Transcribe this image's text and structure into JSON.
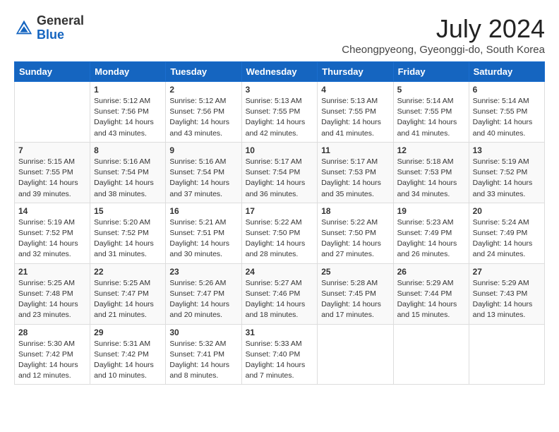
{
  "header": {
    "logo_general": "General",
    "logo_blue": "Blue",
    "month_title": "July 2024",
    "location": "Cheongpyeong, Gyeonggi-do, South Korea"
  },
  "weekdays": [
    "Sunday",
    "Monday",
    "Tuesday",
    "Wednesday",
    "Thursday",
    "Friday",
    "Saturday"
  ],
  "weeks": [
    [
      {
        "day": "",
        "info": ""
      },
      {
        "day": "1",
        "info": "Sunrise: 5:12 AM\nSunset: 7:56 PM\nDaylight: 14 hours\nand 43 minutes."
      },
      {
        "day": "2",
        "info": "Sunrise: 5:12 AM\nSunset: 7:56 PM\nDaylight: 14 hours\nand 43 minutes."
      },
      {
        "day": "3",
        "info": "Sunrise: 5:13 AM\nSunset: 7:55 PM\nDaylight: 14 hours\nand 42 minutes."
      },
      {
        "day": "4",
        "info": "Sunrise: 5:13 AM\nSunset: 7:55 PM\nDaylight: 14 hours\nand 41 minutes."
      },
      {
        "day": "5",
        "info": "Sunrise: 5:14 AM\nSunset: 7:55 PM\nDaylight: 14 hours\nand 41 minutes."
      },
      {
        "day": "6",
        "info": "Sunrise: 5:14 AM\nSunset: 7:55 PM\nDaylight: 14 hours\nand 40 minutes."
      }
    ],
    [
      {
        "day": "7",
        "info": "Sunrise: 5:15 AM\nSunset: 7:55 PM\nDaylight: 14 hours\nand 39 minutes."
      },
      {
        "day": "8",
        "info": "Sunrise: 5:16 AM\nSunset: 7:54 PM\nDaylight: 14 hours\nand 38 minutes."
      },
      {
        "day": "9",
        "info": "Sunrise: 5:16 AM\nSunset: 7:54 PM\nDaylight: 14 hours\nand 37 minutes."
      },
      {
        "day": "10",
        "info": "Sunrise: 5:17 AM\nSunset: 7:54 PM\nDaylight: 14 hours\nand 36 minutes."
      },
      {
        "day": "11",
        "info": "Sunrise: 5:17 AM\nSunset: 7:53 PM\nDaylight: 14 hours\nand 35 minutes."
      },
      {
        "day": "12",
        "info": "Sunrise: 5:18 AM\nSunset: 7:53 PM\nDaylight: 14 hours\nand 34 minutes."
      },
      {
        "day": "13",
        "info": "Sunrise: 5:19 AM\nSunset: 7:52 PM\nDaylight: 14 hours\nand 33 minutes."
      }
    ],
    [
      {
        "day": "14",
        "info": "Sunrise: 5:19 AM\nSunset: 7:52 PM\nDaylight: 14 hours\nand 32 minutes."
      },
      {
        "day": "15",
        "info": "Sunrise: 5:20 AM\nSunset: 7:52 PM\nDaylight: 14 hours\nand 31 minutes."
      },
      {
        "day": "16",
        "info": "Sunrise: 5:21 AM\nSunset: 7:51 PM\nDaylight: 14 hours\nand 30 minutes."
      },
      {
        "day": "17",
        "info": "Sunrise: 5:22 AM\nSunset: 7:50 PM\nDaylight: 14 hours\nand 28 minutes."
      },
      {
        "day": "18",
        "info": "Sunrise: 5:22 AM\nSunset: 7:50 PM\nDaylight: 14 hours\nand 27 minutes."
      },
      {
        "day": "19",
        "info": "Sunrise: 5:23 AM\nSunset: 7:49 PM\nDaylight: 14 hours\nand 26 minutes."
      },
      {
        "day": "20",
        "info": "Sunrise: 5:24 AM\nSunset: 7:49 PM\nDaylight: 14 hours\nand 24 minutes."
      }
    ],
    [
      {
        "day": "21",
        "info": "Sunrise: 5:25 AM\nSunset: 7:48 PM\nDaylight: 14 hours\nand 23 minutes."
      },
      {
        "day": "22",
        "info": "Sunrise: 5:25 AM\nSunset: 7:47 PM\nDaylight: 14 hours\nand 21 minutes."
      },
      {
        "day": "23",
        "info": "Sunrise: 5:26 AM\nSunset: 7:47 PM\nDaylight: 14 hours\nand 20 minutes."
      },
      {
        "day": "24",
        "info": "Sunrise: 5:27 AM\nSunset: 7:46 PM\nDaylight: 14 hours\nand 18 minutes."
      },
      {
        "day": "25",
        "info": "Sunrise: 5:28 AM\nSunset: 7:45 PM\nDaylight: 14 hours\nand 17 minutes."
      },
      {
        "day": "26",
        "info": "Sunrise: 5:29 AM\nSunset: 7:44 PM\nDaylight: 14 hours\nand 15 minutes."
      },
      {
        "day": "27",
        "info": "Sunrise: 5:29 AM\nSunset: 7:43 PM\nDaylight: 14 hours\nand 13 minutes."
      }
    ],
    [
      {
        "day": "28",
        "info": "Sunrise: 5:30 AM\nSunset: 7:42 PM\nDaylight: 14 hours\nand 12 minutes."
      },
      {
        "day": "29",
        "info": "Sunrise: 5:31 AM\nSunset: 7:42 PM\nDaylight: 14 hours\nand 10 minutes."
      },
      {
        "day": "30",
        "info": "Sunrise: 5:32 AM\nSunset: 7:41 PM\nDaylight: 14 hours\nand 8 minutes."
      },
      {
        "day": "31",
        "info": "Sunrise: 5:33 AM\nSunset: 7:40 PM\nDaylight: 14 hours\nand 7 minutes."
      },
      {
        "day": "",
        "info": ""
      },
      {
        "day": "",
        "info": ""
      },
      {
        "day": "",
        "info": ""
      }
    ]
  ]
}
